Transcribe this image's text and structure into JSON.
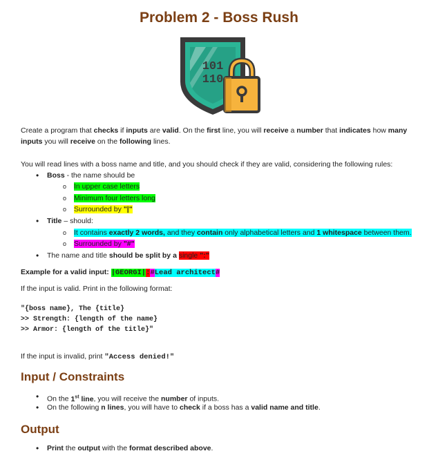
{
  "title": "Problem 2 - Boss Rush",
  "icon": {
    "name": "shield-lock-icon",
    "text_top": "101",
    "text_bottom": "110",
    "colors": {
      "shield": "#2bb596",
      "shield_dark": "#23907a",
      "outline": "#3a3a3a",
      "lock": "#f6b33d",
      "lock_dark": "#e09a26",
      "binary": "#3a3a3a"
    }
  },
  "intro": {
    "p1": [
      {
        "t": "Create a program that ",
        "b": false
      },
      {
        "t": "checks",
        "b": true
      },
      {
        "t": " if ",
        "b": false
      },
      {
        "t": "inputs",
        "b": true
      },
      {
        "t": " are ",
        "b": false
      },
      {
        "t": "valid",
        "b": true
      },
      {
        "t": ". On the ",
        "b": false
      },
      {
        "t": "first",
        "b": true
      },
      {
        "t": " line, you will ",
        "b": false
      },
      {
        "t": "receive",
        "b": true
      },
      {
        "t": " a ",
        "b": false
      },
      {
        "t": "number",
        "b": true
      },
      {
        "t": " that ",
        "b": false
      },
      {
        "t": "indicates",
        "b": true
      },
      {
        "t": " how ",
        "b": false
      },
      {
        "t": "many",
        "b": true
      }
    ],
    "p1b": [
      {
        "t": "inputs",
        "b": true
      },
      {
        "t": " you will ",
        "b": false
      },
      {
        "t": "receive",
        "b": true
      },
      {
        "t": " on the ",
        "b": false
      },
      {
        "t": "following",
        "b": true
      },
      {
        "t": " lines.",
        "b": false
      }
    ],
    "p2": "You will read lines with a boss name and title, and you should check if they are valid, considering the following rules:"
  },
  "rules": {
    "boss_label": "Boss",
    "boss_suffix": " - the name should be",
    "boss_items": [
      "In upper case letters",
      "Minimum four letters long",
      "Surrounded by "
    ],
    "boss_surround": "\"|\"",
    "title_label": "Title",
    "title_suffix": " – should:",
    "title_item1": [
      {
        "t": "It contains ",
        "b": false
      },
      {
        "t": "exactly 2 words,",
        "b": true
      },
      {
        "t": " and they ",
        "b": false
      },
      {
        "t": "contain",
        "b": true
      },
      {
        "t": " only alphabetical letters and ",
        "b": false
      },
      {
        "t": "1 whitespace",
        "b": true
      },
      {
        "t": " between them.",
        "b": false
      }
    ],
    "title_item2_text": "Surrounded by ",
    "title_item2_sym": "\"#\"",
    "split_pre": "The name and title ",
    "split_bold": "should be split by a",
    "split_hl": "single",
    "split_sym": " \":\""
  },
  "example": {
    "label": "Example for a valid input: ",
    "part_boss": "|GEORGI|",
    "part_colon": ":",
    "part_title_open": "#",
    "part_title": "Lead architect",
    "part_title_close": "#"
  },
  "format_intro": "If the input is valid. Print in the following format:",
  "format_block": "\"{boss name}, The {title}\n>> Strength: {length of the name}\n>> Armor: {length of the title}\"",
  "invalid_pre": "If the input is invalid, print ",
  "invalid_msg": "\"Access denied!\"",
  "section_input": "Input / Constraints",
  "input_items": {
    "i1_pre": "On the ",
    "i1_bold": "1",
    "i1_sup": "st",
    "i1_bold2": " line",
    "i1_mid": ", you will receive the ",
    "i1_bold3": "number",
    "i1_end": " of inputs.",
    "i2_pre": "On the following ",
    "i2_bold": "n lines",
    "i2_mid": ", you will have to ",
    "i2_bold2": "check",
    "i2_mid2": " if a boss has a ",
    "i2_bold3": "valid name and title",
    "i2_end": "."
  },
  "section_output": "Output",
  "output_item": {
    "o_bold": "Print",
    "o_mid": " the ",
    "o_bold2": "output",
    "o_mid2": " with the ",
    "o_bold3": "format described above",
    "o_end": "."
  }
}
